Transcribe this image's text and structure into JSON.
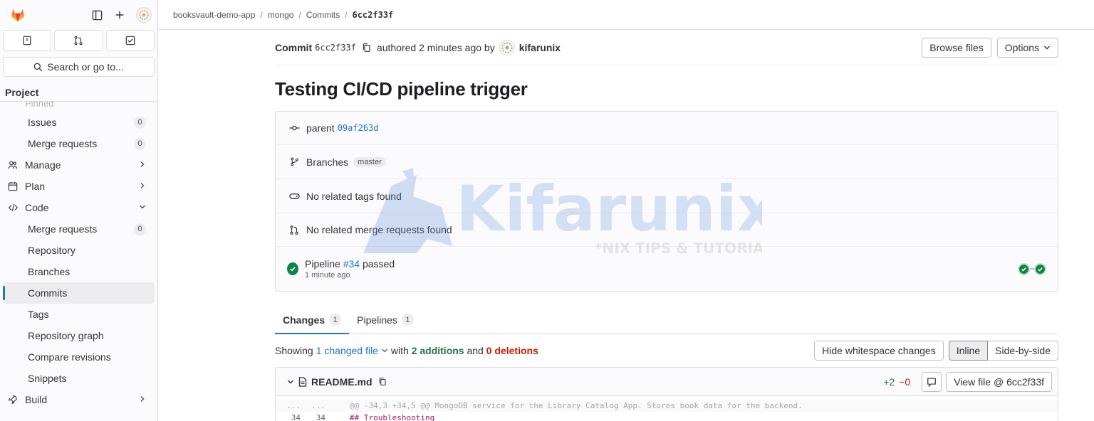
{
  "sidebar": {
    "search_label": "Search or go to...",
    "section_title": "Project",
    "pinned_label": "Pinned",
    "items": [
      {
        "label": "Issues",
        "badge": "0"
      },
      {
        "label": "Merge requests",
        "badge": "0"
      },
      {
        "label": "Manage"
      },
      {
        "label": "Plan"
      },
      {
        "label": "Code"
      },
      {
        "label": "Merge requests",
        "badge": "0"
      },
      {
        "label": "Repository"
      },
      {
        "label": "Branches"
      },
      {
        "label": "Commits"
      },
      {
        "label": "Tags"
      },
      {
        "label": "Repository graph"
      },
      {
        "label": "Compare revisions"
      },
      {
        "label": "Snippets"
      },
      {
        "label": "Build"
      }
    ]
  },
  "breadcrumb": {
    "items": [
      "booksvault-demo-app",
      "mongo",
      "Commits",
      "6cc2f33f"
    ]
  },
  "commit": {
    "label": "Commit",
    "sha": "6cc2f33f",
    "authored_text": "authored 2 minutes ago by",
    "author": "kifarunix",
    "browse_files": "Browse files",
    "options": "Options",
    "title": "Testing CI/CD pipeline trigger",
    "parent_label": "parent",
    "parent_sha": "09af263d",
    "branches_label": "Branches",
    "branch": "master",
    "tags_text": "No related tags found",
    "mr_text": "No related merge requests found",
    "pipeline_label": "Pipeline",
    "pipeline_id": "#34",
    "pipeline_status": "passed",
    "pipeline_time": "1 minute ago"
  },
  "tabs": [
    {
      "label": "Changes",
      "count": "1"
    },
    {
      "label": "Pipelines",
      "count": "1"
    }
  ],
  "showing": {
    "prefix": "Showing",
    "changed": "1 changed file",
    "with": "with",
    "additions": "2 additions",
    "and": "and",
    "deletions": "0 deletions",
    "hide_whitespace": "Hide whitespace changes",
    "inline": "Inline",
    "side_by_side": "Side-by-side"
  },
  "file": {
    "name": "README.md",
    "additions": "+2",
    "deletions": "−0",
    "view_file": "View file @ 6cc2f33f",
    "hunk_dots_old": "...",
    "hunk_dots_new": "...",
    "hunk": "@@ -34,3 +34,5 @@ MongoDB service for the Library Catalog App. Stores book data for the backend.",
    "line_old": "34",
    "line_new": "34",
    "line_code": "## Troubleshooting"
  },
  "watermark": {
    "name": "Kifarunix",
    "tagline": "*NIX TIPS & TUTORIALS"
  },
  "colors": {
    "link": "#1f75cb",
    "success": "#108548",
    "danger": "#c91c00",
    "brand": "#fc6d26"
  }
}
